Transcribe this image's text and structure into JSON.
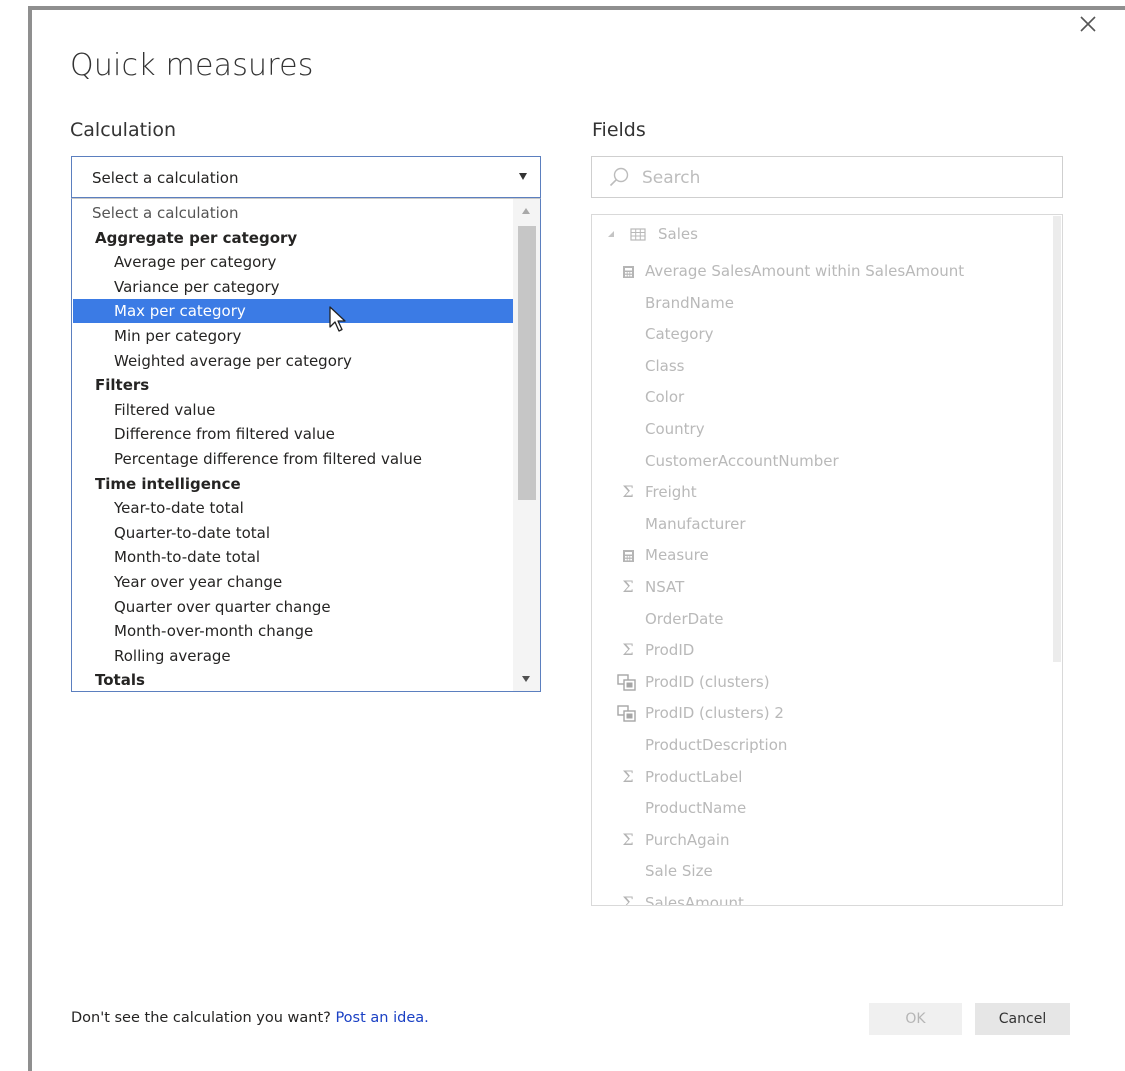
{
  "dialog": {
    "title": "Quick measures",
    "close_icon": "close-icon"
  },
  "calculation": {
    "label": "Calculation",
    "selected_value": "Select a calculation",
    "options": [
      {
        "label": "Select a calculation",
        "kind": "placeholder"
      },
      {
        "label": "Aggregate per category",
        "kind": "group"
      },
      {
        "label": "Average per category",
        "kind": "item"
      },
      {
        "label": "Variance per category",
        "kind": "item"
      },
      {
        "label": "Max per category",
        "kind": "item",
        "selected": true
      },
      {
        "label": "Min per category",
        "kind": "item"
      },
      {
        "label": "Weighted average per category",
        "kind": "item"
      },
      {
        "label": "Filters",
        "kind": "group"
      },
      {
        "label": "Filtered value",
        "kind": "item"
      },
      {
        "label": "Difference from filtered value",
        "kind": "item"
      },
      {
        "label": "Percentage difference from filtered value",
        "kind": "item"
      },
      {
        "label": "Time intelligence",
        "kind": "group"
      },
      {
        "label": "Year-to-date total",
        "kind": "item"
      },
      {
        "label": "Quarter-to-date total",
        "kind": "item"
      },
      {
        "label": "Month-to-date total",
        "kind": "item"
      },
      {
        "label": "Year over year change",
        "kind": "item"
      },
      {
        "label": "Quarter over quarter change",
        "kind": "item"
      },
      {
        "label": "Month-over-month change",
        "kind": "item"
      },
      {
        "label": "Rolling average",
        "kind": "item"
      },
      {
        "label": "Totals",
        "kind": "group"
      }
    ],
    "selection_color": "#3b7be5"
  },
  "fields": {
    "label": "Fields",
    "search_placeholder": "Search",
    "table": {
      "name": "Sales",
      "icon": "table-icon"
    },
    "items": [
      {
        "label": "Average SalesAmount within SalesAmount",
        "icon": "calculator-icon"
      },
      {
        "label": "BrandName",
        "icon": ""
      },
      {
        "label": "Category",
        "icon": ""
      },
      {
        "label": "Class",
        "icon": ""
      },
      {
        "label": "Color",
        "icon": ""
      },
      {
        "label": "Country",
        "icon": ""
      },
      {
        "label": "CustomerAccountNumber",
        "icon": ""
      },
      {
        "label": "Freight",
        "icon": "sigma-icon"
      },
      {
        "label": "Manufacturer",
        "icon": ""
      },
      {
        "label": "Measure",
        "icon": "calculator-icon"
      },
      {
        "label": "NSAT",
        "icon": "sigma-icon"
      },
      {
        "label": "OrderDate",
        "icon": ""
      },
      {
        "label": "ProdID",
        "icon": "sigma-icon"
      },
      {
        "label": "ProdID (clusters)",
        "icon": "cluster-icon"
      },
      {
        "label": "ProdID (clusters) 2",
        "icon": "cluster-icon"
      },
      {
        "label": "ProductDescription",
        "icon": ""
      },
      {
        "label": "ProductLabel",
        "icon": "sigma-icon"
      },
      {
        "label": "ProductName",
        "icon": ""
      },
      {
        "label": "PurchAgain",
        "icon": "sigma-icon"
      },
      {
        "label": "Sale Size",
        "icon": ""
      },
      {
        "label": "SalesAmount",
        "icon": "sigma-icon"
      }
    ]
  },
  "footer": {
    "prompt": "Don't see the calculation you want?",
    "link": "Post an idea."
  },
  "buttons": {
    "ok": "OK",
    "cancel": "Cancel"
  }
}
